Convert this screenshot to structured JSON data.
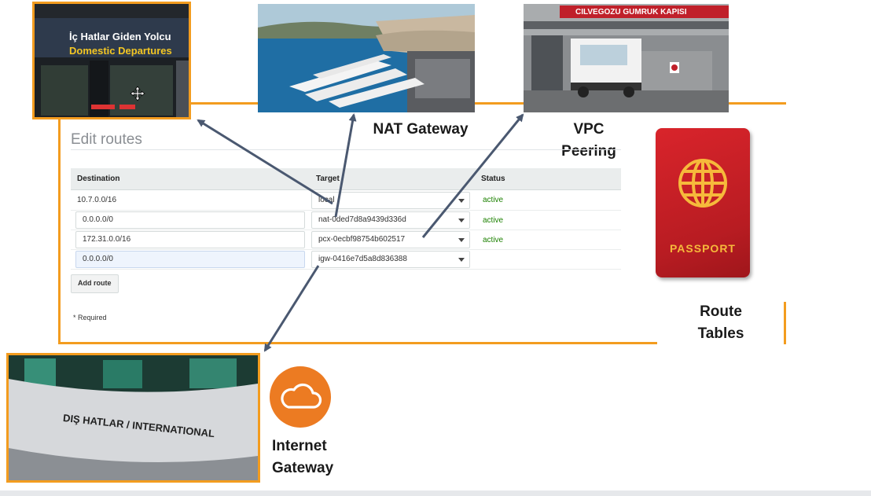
{
  "photos": {
    "domestic": {
      "sign_line1": "İç Hatlar Giden Yolcu",
      "sign_line2": "Domestic Departures"
    },
    "customs": {
      "banner": "CILVEGOZU GUMRUK KAPISI"
    },
    "international": {
      "sign": "DIŞ HATLAR / INTERNATIONAL"
    }
  },
  "labels": {
    "nat_gateway": "NAT Gateway",
    "vpc_peering_line1": "VPC",
    "vpc_peering_line2": "Peering",
    "route_tables_line1": "Route",
    "route_tables_line2": "Tables",
    "internet_gateway_line1": "Internet",
    "internet_gateway_line2": "Gateway"
  },
  "passport": {
    "label": "PASSPORT"
  },
  "edit_routes": {
    "title": "Edit routes",
    "columns": {
      "destination": "Destination",
      "target": "Target",
      "status": "Status"
    },
    "rows": [
      {
        "destination": "10.7.0.0/16",
        "target": "local",
        "status": "active"
      },
      {
        "destination": "0.0.0.0/0",
        "target": "nat-0ded7d8a9439d336d",
        "status": "active"
      },
      {
        "destination": "172.31.0.0/16",
        "target": "pcx-0ecbf98754b602517",
        "status": "active"
      },
      {
        "destination": "0.0.0.0/0",
        "target": "igw-0416e7d5a8d836388",
        "status": ""
      }
    ],
    "add_route_label": "Add route",
    "required_note": "* Required"
  },
  "colors": {
    "accent_orange": "#f39c1f",
    "arrow": "#4a5870",
    "status_active": "#1d8102",
    "passport_red": "#c41f26",
    "cloud_orange": "#ec7b22"
  },
  "icons": [
    "move-cursor-icon",
    "globe-icon",
    "cloud-icon",
    "dropdown-caret-icon"
  ]
}
